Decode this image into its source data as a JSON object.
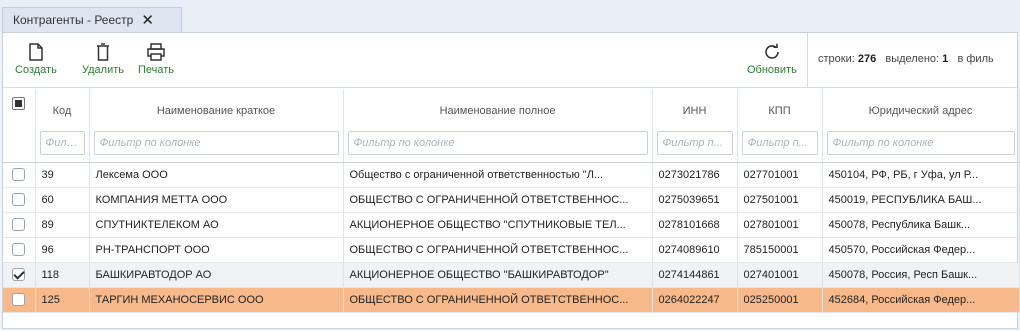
{
  "tab": {
    "title": "Контрагенты - Реестр",
    "close_glyph": "✕"
  },
  "toolbar": {
    "create_label": "Создать",
    "delete_label": "Удалить",
    "print_label": "Печать",
    "refresh_label": "Обновить",
    "accent_color": "#2e7d32"
  },
  "status": {
    "rows_label": "строки:",
    "rows_count": "276",
    "selected_label": "выделено:",
    "selected_count": "1",
    "filter_label": "в филь"
  },
  "grid": {
    "columns": [
      {
        "title": ""
      },
      {
        "title": "Код",
        "filter": "Филь..."
      },
      {
        "title": "Наименование краткое",
        "filter": "Фильтр по колонке"
      },
      {
        "title": "Наименование полное",
        "filter": "Фильтр по колонке"
      },
      {
        "title": "ИНН",
        "filter": "Фильтр п..."
      },
      {
        "title": "КПП",
        "filter": "Фильтр п..."
      },
      {
        "title": "Юридический адрес",
        "filter": "Фильтр по колонке"
      }
    ],
    "rows": [
      {
        "checked": false,
        "state": "",
        "code": "39",
        "short": "Лексема ООО",
        "full": "Общество с ограниченной ответственностью \"Л...",
        "inn": "0273021786",
        "kpp": "027701001",
        "address": "450104, РФ, РБ, г Уфа, ул Р..."
      },
      {
        "checked": false,
        "state": "",
        "code": "60",
        "short": "КОМПАНИЯ МЕТТА ООО",
        "full": "ОБЩЕСТВО С ОГРАНИЧЕННОЙ ОТВЕТСТВЕННОС...",
        "inn": "0275039651",
        "kpp": "027501001",
        "address": "450019, РЕСПУБЛИКА БАШ..."
      },
      {
        "checked": false,
        "state": "",
        "code": "89",
        "short": "СПУТНИКТЕЛЕКОМ АО",
        "full": "АКЦИОНЕРНОЕ ОБЩЕСТВО \"СПУТНИКОВЫЕ ТЕЛ...",
        "inn": "0278101668",
        "kpp": "027801001",
        "address": "450078, Республика Башк..."
      },
      {
        "checked": false,
        "state": "",
        "code": "96",
        "short": "РН-ТРАНСПОРТ ООО",
        "full": "ОБЩЕСТВО С ОГРАНИЧЕННОЙ ОТВЕТСТВЕННОС...",
        "inn": "0274089610",
        "kpp": "785150001",
        "address": "450570, Российская Федер..."
      },
      {
        "checked": true,
        "state": "selected",
        "code": "118",
        "short": "БАШКИРАВТОДОР АО",
        "full": "АКЦИОНЕРНОЕ ОБЩЕСТВО \"БАШКИРАВТОДОР\"",
        "inn": "0274144861",
        "kpp": "027401001",
        "address": "450078, Россия, Респ Башк..."
      },
      {
        "checked": false,
        "state": "focused",
        "code": "125",
        "short": "ТАРГИН МЕХАНОСЕРВИС ООО",
        "full": "ОБЩЕСТВО С ОГРАНИЧЕННОЙ ОТВЕТСТВЕННОС...",
        "inn": "0264022247",
        "kpp": "025250001",
        "address": "452684, Российская Федер..."
      }
    ],
    "row_colors": {
      "selected": "#f0f2f5",
      "focused": "#f8b98a"
    }
  }
}
